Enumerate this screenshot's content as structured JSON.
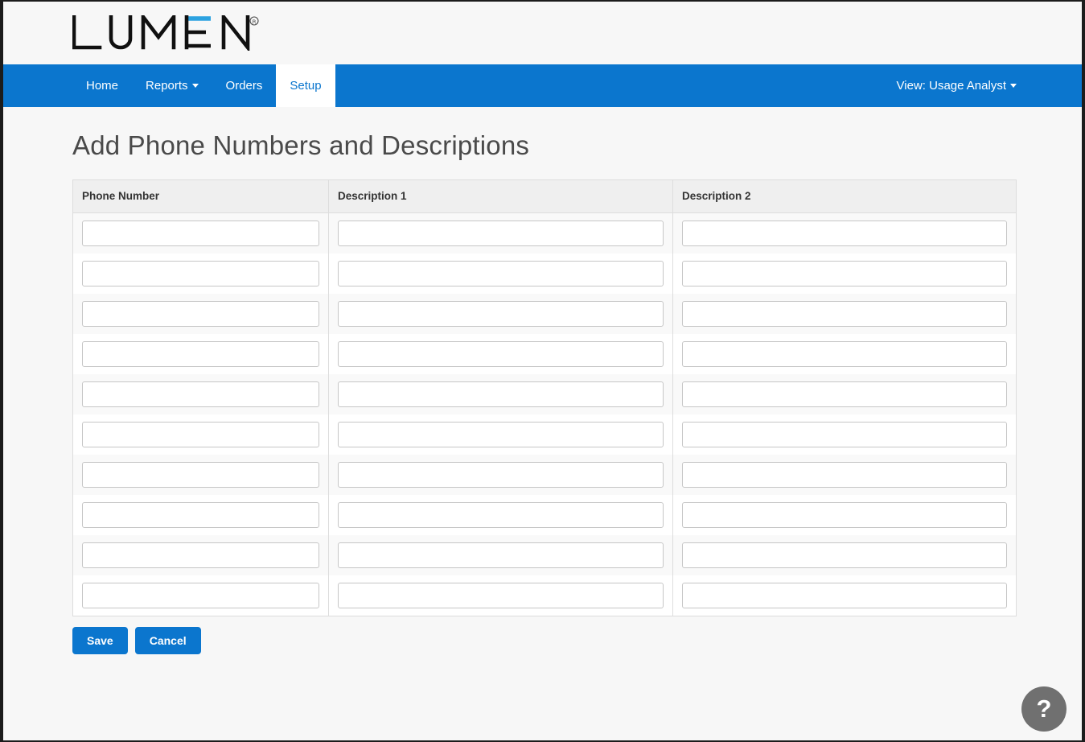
{
  "brand": {
    "logo_text": "LUMEN",
    "logo_registered": "®",
    "accent_color": "#2ca2e0",
    "text_color": "#101010"
  },
  "nav": {
    "background_color": "#0b76ce",
    "items": [
      {
        "label": "Home",
        "has_caret": false,
        "active": false
      },
      {
        "label": "Reports",
        "has_caret": true,
        "active": false
      },
      {
        "label": "Orders",
        "has_caret": false,
        "active": false
      },
      {
        "label": "Setup",
        "has_caret": false,
        "active": true
      }
    ],
    "view_switch": {
      "label": "View: Usage Analyst",
      "caret_icon": "caret-down-icon"
    }
  },
  "main": {
    "page_title": "Add Phone Numbers and Descriptions",
    "table": {
      "columns": [
        "Phone Number",
        "Description 1",
        "Description 2"
      ],
      "rows": [
        {
          "phone_number": "",
          "description_1": "",
          "description_2": ""
        },
        {
          "phone_number": "",
          "description_1": "",
          "description_2": ""
        },
        {
          "phone_number": "",
          "description_1": "",
          "description_2": ""
        },
        {
          "phone_number": "",
          "description_1": "",
          "description_2": ""
        },
        {
          "phone_number": "",
          "description_1": "",
          "description_2": ""
        },
        {
          "phone_number": "",
          "description_1": "",
          "description_2": ""
        },
        {
          "phone_number": "",
          "description_1": "",
          "description_2": ""
        },
        {
          "phone_number": "",
          "description_1": "",
          "description_2": ""
        },
        {
          "phone_number": "",
          "description_1": "",
          "description_2": ""
        },
        {
          "phone_number": "",
          "description_1": "",
          "description_2": ""
        }
      ]
    },
    "buttons": {
      "save_label": "Save",
      "cancel_label": "Cancel",
      "button_color": "#0b76ce"
    }
  },
  "help": {
    "icon": "question-mark-icon",
    "glyph": "?",
    "background_color": "#707070"
  }
}
